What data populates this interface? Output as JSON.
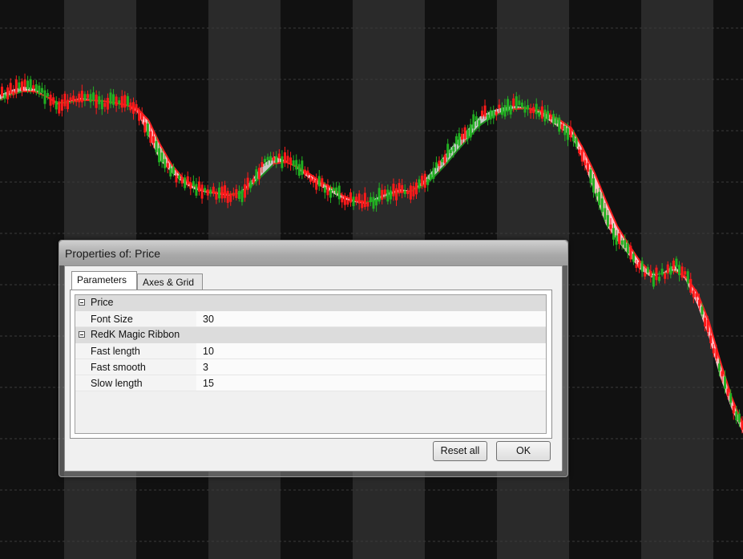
{
  "dialog": {
    "title": "Properties of: Price",
    "tabs": [
      {
        "label": "Parameters",
        "active": true
      },
      {
        "label": "Axes & Grid",
        "active": false
      }
    ],
    "groups": [
      {
        "name": "Price",
        "properties": [
          {
            "label": "Font Size",
            "value": "30"
          }
        ]
      },
      {
        "name": "RedK Magic Ribbon",
        "properties": [
          {
            "label": "Fast length",
            "value": "10"
          },
          {
            "label": "Fast smooth",
            "value": "3"
          },
          {
            "label": "Slow length",
            "value": "15"
          }
        ]
      }
    ],
    "buttons": {
      "reset_label": "Reset all",
      "ok_label": "OK"
    }
  },
  "colors": {
    "background": "#111111",
    "band": "#2a2a2a",
    "up_candle": "#22b022",
    "down_candle": "#ff1a1a",
    "ribbon_down_fill": "#ffc0c8",
    "ribbon_up_fill": "#c8c8c8",
    "ribbon_fast_up": "#1e8a1e",
    "ribbon_fast_down": "#ff2020"
  },
  "chart_data": {
    "type": "line",
    "grid": true,
    "series": [
      {
        "role": "price-ribbon",
        "values": [
          118,
          112,
          108,
          110,
          120,
          130,
          126,
          122,
          124,
          126,
          128,
          130,
          140,
          170,
          200,
          215,
          228,
          236,
          240,
          242,
          244,
          240,
          225,
          205,
          195,
          200,
          210,
          222,
          232,
          240,
          248,
          252,
          254,
          246,
          240,
          236,
          238,
          226,
          210,
          192,
          175,
          160,
          145,
          138,
          134,
          132,
          134,
          140,
          150,
          160,
          170,
          200,
          240,
          280,
          300,
          318,
          336,
          346,
          340,
          330,
          350,
          380,
          420,
          470,
          510,
          540
        ]
      },
      {
        "role": "ribbon-slow",
        "values": [
          125,
          118,
          114,
          114,
          120,
          128,
          128,
          125,
          125,
          126,
          128,
          131,
          135,
          150,
          180,
          205,
          222,
          232,
          238,
          240,
          242,
          241,
          232,
          218,
          204,
          202,
          208,
          216,
          226,
          234,
          244,
          250,
          252,
          250,
          244,
          240,
          238,
          232,
          220,
          205,
          188,
          172,
          156,
          146,
          140,
          136,
          135,
          137,
          142,
          150,
          160,
          185,
          215,
          250,
          282,
          305,
          326,
          340,
          342,
          338,
          345,
          365,
          400,
          450,
          495,
          530
        ]
      }
    ]
  }
}
